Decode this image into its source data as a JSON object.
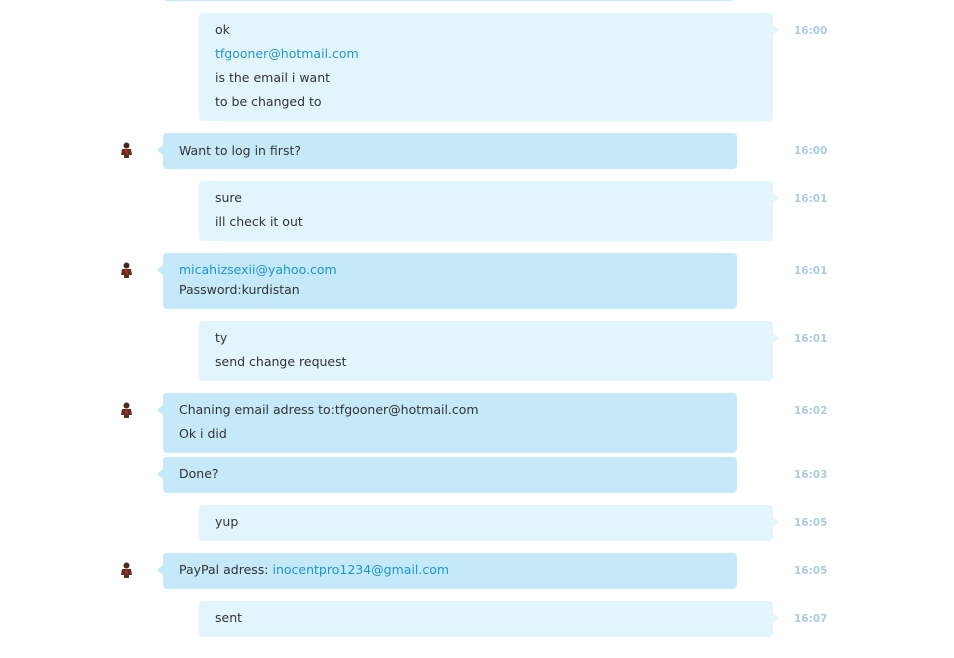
{
  "messages": [
    {
      "sender": "me",
      "time": "16:00",
      "lines": [
        "ok",
        "tfgooner@hotmail.com",
        "is the email i want",
        "to be changed to"
      ]
    },
    {
      "sender": "other",
      "time": "16:00",
      "lines": [
        "Want to log in first?"
      ]
    },
    {
      "sender": "me",
      "time": "16:01",
      "lines": [
        "sure",
        "ill check it out"
      ]
    },
    {
      "sender": "other",
      "time": "16:01",
      "lines": [
        "micahizsexii@yahoo.com",
        "Password:kurdistan"
      ]
    },
    {
      "sender": "me",
      "time": "16:01",
      "lines": [
        "ty",
        "send change request"
      ]
    },
    {
      "sender": "other",
      "time": "16:02",
      "lines": [
        "Chaning email adress to:tfgooner@hotmail.com",
        "Ok i did"
      ]
    },
    {
      "sender": "other",
      "time": "16:03",
      "lines": [
        "Done?"
      ]
    },
    {
      "sender": "me",
      "time": "16:05",
      "lines": [
        "yup"
      ]
    },
    {
      "sender": "other",
      "time": "16:05",
      "lines": [
        "PayPal adress: ",
        "inocentpro1234@gmail.com"
      ]
    },
    {
      "sender": "me",
      "time": "16:07",
      "lines": [
        "sent"
      ]
    }
  ],
  "icons": {
    "avatar": "user-avatar-icon"
  },
  "colors": {
    "incoming_bubble": "#c5e9f8",
    "outgoing_bubble": "#e3f5fc",
    "link": "#1a98d0",
    "timestamp": "#a8cde0"
  }
}
